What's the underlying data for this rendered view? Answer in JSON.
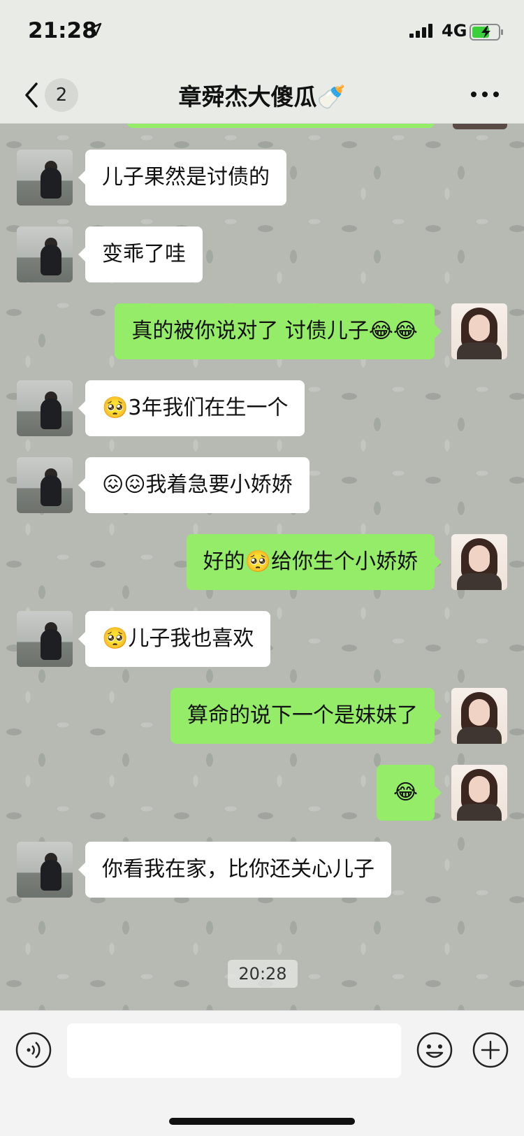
{
  "status_bar": {
    "time": "21:28",
    "network": "4G"
  },
  "header": {
    "back_label": "<",
    "unread_count": "2",
    "title": "章舜杰大傻瓜🍼"
  },
  "messages": [
    {
      "side": "in",
      "text": "儿子果然是讨债的"
    },
    {
      "side": "in",
      "text": "变乖了哇"
    },
    {
      "side": "out",
      "text": "真的被你说对了 讨债儿子😂😂"
    },
    {
      "side": "in",
      "text": "🥺3年我们在生一个"
    },
    {
      "side": "in",
      "text": "😖😖我着急要小娇娇"
    },
    {
      "side": "out",
      "text": "好的🥺给你生个小娇娇"
    },
    {
      "side": "in",
      "text": "🥺儿子我也喜欢"
    },
    {
      "side": "out",
      "text": "算命的说下一个是妹妹了"
    },
    {
      "side": "out",
      "text": "😂"
    },
    {
      "side": "in",
      "text": "你看我在家，比你还关心儿子"
    }
  ],
  "timestamp": "20:28",
  "input": {
    "value": ""
  },
  "colors": {
    "outgoing_bubble": "#95ec69",
    "incoming_bubble": "#ffffff",
    "chat_bg": "#b6bab3"
  }
}
